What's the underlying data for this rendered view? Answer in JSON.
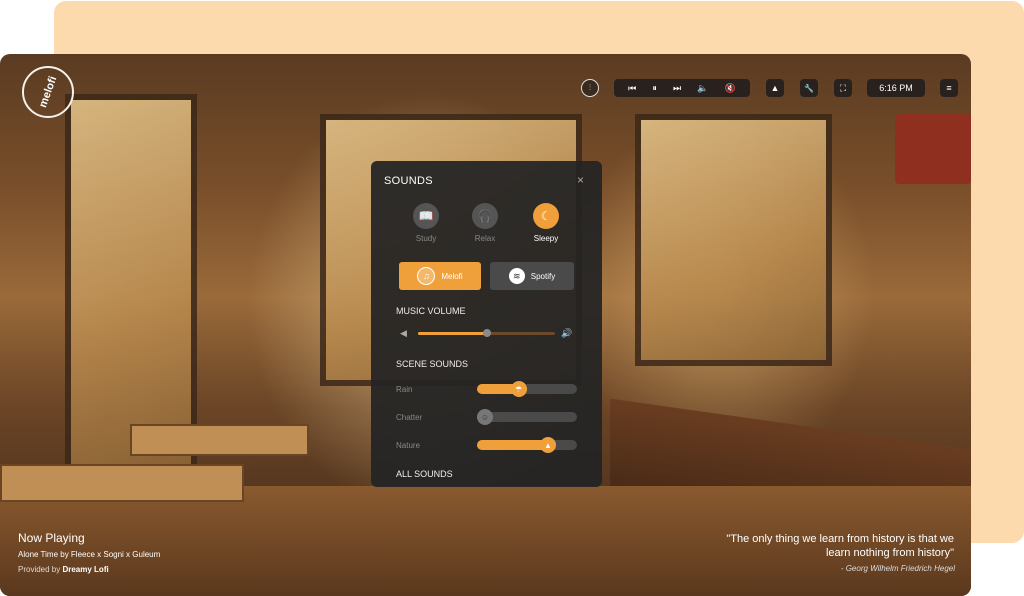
{
  "topbar": {
    "mixer_icon": "mixer-icon",
    "player": {
      "prev_icon": "⏮",
      "pause_icon": "⏸",
      "next_icon": "⏭",
      "volume_icon": "🔈",
      "mute_icon": "🔇"
    },
    "scene_icon": "▲",
    "settings_icon": "🔧",
    "fullscreen_icon": "⛶",
    "clock": "6:16 PM",
    "menu_icon": "≡"
  },
  "sounds_modal": {
    "title": "SOUNDS",
    "close_icon": "×",
    "modes": [
      {
        "label": "Study",
        "icon": "📖",
        "active": false
      },
      {
        "label": "Relax",
        "icon": "🎧",
        "active": false
      },
      {
        "label": "Sleepy",
        "icon": "☾",
        "active": true
      }
    ],
    "sources": [
      {
        "label": "Melofi",
        "icon": "♫",
        "active": true
      },
      {
        "label": "Spotify",
        "icon": "≋",
        "active": false
      }
    ],
    "music_volume_label": "MUSIC VOLUME",
    "music_volume": 0.5,
    "scene_sounds_label": "SCENE SOUNDS",
    "scene_sounds": [
      {
        "label": "Rain",
        "level": 0.4,
        "icon": "☂"
      },
      {
        "label": "Chatter",
        "level": 0.0,
        "icon": "☺"
      },
      {
        "label": "Nature",
        "level": 0.75,
        "icon": "▲"
      }
    ],
    "all_sounds_label": "ALL SOUNDS"
  },
  "now_playing": {
    "heading": "Now Playing",
    "track": "Alone Time by Fleece x Sogni x Guleum",
    "provided_by_prefix": "Provided by ",
    "provider": "Dreamy Lofi"
  },
  "quote": {
    "text": "\"The only thing we learn from history is that we learn nothing from history\"",
    "author": "- Georg Wilhelm Friedrich Hegel"
  },
  "colors": {
    "accent": "#f0a03a",
    "peach_bg": "#fdd9ae",
    "modal_bg": "#242424"
  }
}
